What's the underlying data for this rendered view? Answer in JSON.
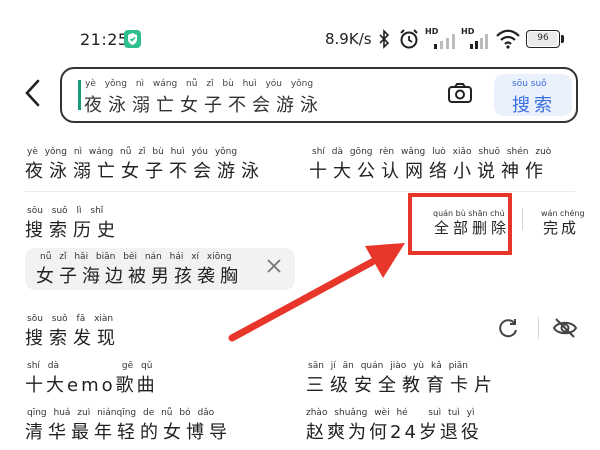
{
  "status_bar": {
    "time": "21:25",
    "net_speed": "8.9K/s",
    "hd1": "HD",
    "hd2": "HD",
    "battery": "96"
  },
  "search": {
    "query_pinyin": "yè yǒng nì wáng nǚ zǐ bù huì yóu yǒng",
    "query_text": "夜泳溺亡女子不会游泳",
    "button_pinyin": "sōu suǒ",
    "button_label": "搜索"
  },
  "suggestions": [
    {
      "pinyin": "yè yǒng nì wáng nǚ zǐ bù huì yóu yǒng",
      "text": "夜泳溺亡女子不会游泳"
    },
    {
      "pinyin": "shí dà gōng rèn wǎng luò xiǎo shuō shén zuò",
      "text": "十大公认网络小说神作"
    }
  ],
  "history": {
    "title_pinyin": "sōu suǒ lì shǐ",
    "title": "搜索历史",
    "delete_all_pinyin": "quán bù shān chú",
    "delete_all": "全部删除",
    "done_pinyin": "wán chéng",
    "done": "完成",
    "items": [
      {
        "pinyin": "nǚ zǐ hǎi biān bèi nán hái xí xiōng",
        "text": "女子海边被男孩袭胸"
      }
    ]
  },
  "discover": {
    "title_pinyin": "sōu suǒ fā xiàn",
    "title": "搜索发现",
    "items": [
      {
        "pinyin": "shí dà        gē qǔ",
        "text": "十大emo歌曲"
      },
      {
        "pinyin": "sān jí ān quán jiào yù kǎ piān",
        "text": "三级安全教育卡片"
      },
      {
        "pinyin": "qīng huá zuì niánqīng de nǚ bó dǎo",
        "text": "清华最年轻的女博导"
      },
      {
        "pinyin": "zhào shuǎng wèi hé   suì tuì yì",
        "text": "赵爽为何24岁退役"
      }
    ]
  },
  "annotation": {
    "color": "#e8372a"
  }
}
